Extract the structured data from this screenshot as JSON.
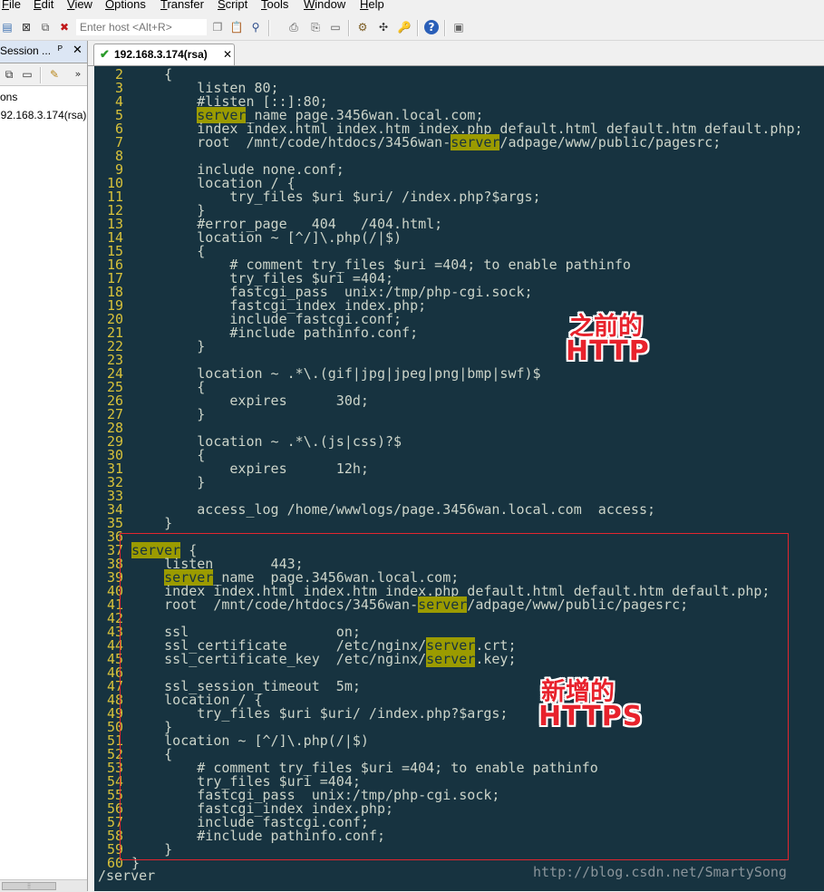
{
  "menu": [
    "File",
    "Edit",
    "View",
    "Options",
    "Transfer",
    "Script",
    "Tools",
    "Window",
    "Help"
  ],
  "toolbar": {
    "host_placeholder": "Enter host <Alt+R>",
    "icons": [
      "connect-icon",
      "quick-connect-icon",
      "reconnect-icon",
      "disconnect-icon",
      "find-icon",
      "copy-icon",
      "paste-icon",
      "print-icon",
      "settings-icon",
      "key-map-icon",
      "keys-icon",
      "help-icon",
      "unlock-icon"
    ]
  },
  "sidebar": {
    "title": "Session ...",
    "rows": [
      "ons",
      "192.168.3.174(rsa)"
    ]
  },
  "tab": {
    "label": "192.168.3.174(rsa)"
  },
  "terminal": {
    "lines": [
      {
        "n": "2",
        "t": "    {"
      },
      {
        "n": "3",
        "t": "        listen 80;"
      },
      {
        "n": "4",
        "t": "        #listen [::]:80;"
      },
      {
        "n": "5",
        "t": "        server_name page.3456wan.local.com;"
      },
      {
        "n": "6",
        "t": "        index index.html index.htm index.php default.html default.htm default.php;"
      },
      {
        "n": "7",
        "t": "        root  /mnt/code/htdocs/3456wan-server/adpage/www/public/pagesrc;"
      },
      {
        "n": "8",
        "t": ""
      },
      {
        "n": "9",
        "t": "        include none.conf;"
      },
      {
        "n": "10",
        "t": "        location / {"
      },
      {
        "n": "11",
        "t": "            try_files $uri $uri/ /index.php?$args;"
      },
      {
        "n": "12",
        "t": "        }"
      },
      {
        "n": "13",
        "t": "        #error_page   404   /404.html;"
      },
      {
        "n": "14",
        "t": "        location ~ [^/]\\.php(/|$)"
      },
      {
        "n": "15",
        "t": "        {"
      },
      {
        "n": "16",
        "t": "            # comment try_files $uri =404; to enable pathinfo"
      },
      {
        "n": "17",
        "t": "            try_files $uri =404;"
      },
      {
        "n": "18",
        "t": "            fastcgi_pass  unix:/tmp/php-cgi.sock;"
      },
      {
        "n": "19",
        "t": "            fastcgi_index index.php;"
      },
      {
        "n": "20",
        "t": "            include fastcgi.conf;"
      },
      {
        "n": "21",
        "t": "            #include pathinfo.conf;"
      },
      {
        "n": "22",
        "t": "        }"
      },
      {
        "n": "23",
        "t": ""
      },
      {
        "n": "24",
        "t": "        location ~ .*\\.(gif|jpg|jpeg|png|bmp|swf)$"
      },
      {
        "n": "25",
        "t": "        {"
      },
      {
        "n": "26",
        "t": "            expires      30d;"
      },
      {
        "n": "27",
        "t": "        }"
      },
      {
        "n": "28",
        "t": ""
      },
      {
        "n": "29",
        "t": "        location ~ .*\\.(js|css)?$"
      },
      {
        "n": "30",
        "t": "        {"
      },
      {
        "n": "31",
        "t": "            expires      12h;"
      },
      {
        "n": "32",
        "t": "        }"
      },
      {
        "n": "33",
        "t": ""
      },
      {
        "n": "34",
        "t": "        access_log /home/wwwlogs/page.3456wan.local.com  access;"
      },
      {
        "n": "35",
        "t": "    }"
      },
      {
        "n": "36",
        "t": ""
      },
      {
        "n": "37",
        "t": "server {"
      },
      {
        "n": "38",
        "t": "    listen       443;"
      },
      {
        "n": "39",
        "t": "    server_name  page.3456wan.local.com;"
      },
      {
        "n": "40",
        "t": "    index index.html index.htm index.php default.html default.htm default.php;"
      },
      {
        "n": "41",
        "t": "    root  /mnt/code/htdocs/3456wan-server/adpage/www/public/pagesrc;"
      },
      {
        "n": "42",
        "t": ""
      },
      {
        "n": "43",
        "t": "    ssl                  on;"
      },
      {
        "n": "44",
        "t": "    ssl_certificate      /etc/nginx/server.crt;"
      },
      {
        "n": "45",
        "t": "    ssl_certificate_key  /etc/nginx/server.key;"
      },
      {
        "n": "46",
        "t": ""
      },
      {
        "n": "47",
        "t": "    ssl_session_timeout  5m;"
      },
      {
        "n": "48",
        "t": "    location / {"
      },
      {
        "n": "49",
        "t": "        try_files $uri $uri/ /index.php?$args;"
      },
      {
        "n": "50",
        "t": "    }"
      },
      {
        "n": "51",
        "t": "    location ~ [^/]\\.php(/|$)"
      },
      {
        "n": "52",
        "t": "    {"
      },
      {
        "n": "53",
        "t": "        # comment try_files $uri =404; to enable pathinfo"
      },
      {
        "n": "54",
        "t": "        try_files $uri =404;"
      },
      {
        "n": "55",
        "t": "        fastcgi_pass  unix:/tmp/php-cgi.sock;"
      },
      {
        "n": "56",
        "t": "        fastcgi_index index.php;"
      },
      {
        "n": "57",
        "t": "        include fastcgi.conf;"
      },
      {
        "n": "58",
        "t": "        #include pathinfo.conf;"
      },
      {
        "n": "59",
        "t": "    }"
      },
      {
        "n": "60",
        "t": "}"
      }
    ],
    "highlight_word": "server",
    "status_line": "/server"
  },
  "annotations": {
    "before_l1": "之前的",
    "before_l2": "HTTP",
    "after_l1": "新增的",
    "after_l2": "HTTPS"
  },
  "watermark": "http://blog.csdn.net/SmartySong",
  "colors": {
    "terminal_bg": "#173340",
    "text": "#ccd4c9",
    "line_number": "#d8c23a",
    "highlight": "#9b9b00",
    "annotation": "#e8222c",
    "box": "#e3262f"
  }
}
